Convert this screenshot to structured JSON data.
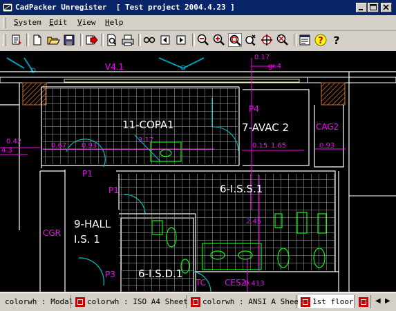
{
  "window": {
    "title": "CadPacker Unregister  [ Test project 2004.4.23 ]",
    "app_icon": "cad-app-icon",
    "controls": [
      "minimize-icon",
      "maximize-icon",
      "close-icon"
    ]
  },
  "menubar": {
    "items": [
      {
        "label": "System"
      },
      {
        "label": "Edit"
      },
      {
        "label": "View"
      },
      {
        "label": "Help"
      }
    ]
  },
  "toolbar": {
    "buttons": [
      {
        "icon": "import-icon"
      },
      {
        "icon": "new-file-icon"
      },
      {
        "icon": "open-folder-icon"
      },
      {
        "icon": "save-icon"
      },
      {
        "icon": "export-icon"
      },
      {
        "icon": "print-preview-icon"
      },
      {
        "icon": "print-icon"
      },
      {
        "icon": "first-page-icon"
      },
      {
        "icon": "previous-page-icon"
      },
      {
        "icon": "next-page-icon"
      },
      {
        "icon": "zoom-out-icon"
      },
      {
        "icon": "zoom-in-icon"
      },
      {
        "icon": "zoom-window-icon"
      },
      {
        "icon": "zoom-realtime-icon"
      },
      {
        "icon": "pan-icon"
      },
      {
        "icon": "zoom-extents-icon"
      },
      {
        "icon": "properties-icon"
      },
      {
        "icon": "help-context-icon"
      },
      {
        "icon": "about-icon"
      }
    ]
  },
  "drawing": {
    "labels": {
      "copa": "11-COPA1",
      "avac": "7-AVAC 2",
      "cag": "CAG2",
      "iss": "6-I.S.S.1",
      "hall_1": "9-HALL",
      "hall_2": "I.S. 1",
      "isd": "6-I.S.D.1",
      "cgr": "CGR",
      "v41": "V4.1",
      "p1a": "P1",
      "p1b": "P1",
      "p3": "P3",
      "p4": "P4",
      "tc": "TC",
      "ces": "CES2",
      "gr4": "gr.4"
    },
    "dimensions": {
      "d017": "0.17",
      "d042": "0.42",
      "d43": "4.3",
      "d067": "0.67",
      "d093a": "0.93",
      "d317": "3.17",
      "d015": "0.15",
      "d165": "1.65",
      "d093b": "0.93",
      "d245": "2.45",
      "d0413": "0.413"
    },
    "colors": {
      "background": "#000000",
      "wall": "#ffffff",
      "fixture": "#00ff00",
      "grid": "#c0c0c0",
      "door": "#00c0c0",
      "dimension": "#ff00ff",
      "wall_hatch": "#d07030"
    }
  },
  "statusbar": {
    "tabs": [
      {
        "label": "colorwh : Modal",
        "active": false,
        "icon": false
      },
      {
        "label": "colorwh : ISO A4 Sheet",
        "active": false,
        "icon": true
      },
      {
        "label": "colorwh : ANSI A Sheet",
        "active": false,
        "icon": true
      },
      {
        "label": "1st floor",
        "active": true,
        "icon": true
      }
    ],
    "scroll_left": "◀",
    "scroll_right": "▶"
  }
}
